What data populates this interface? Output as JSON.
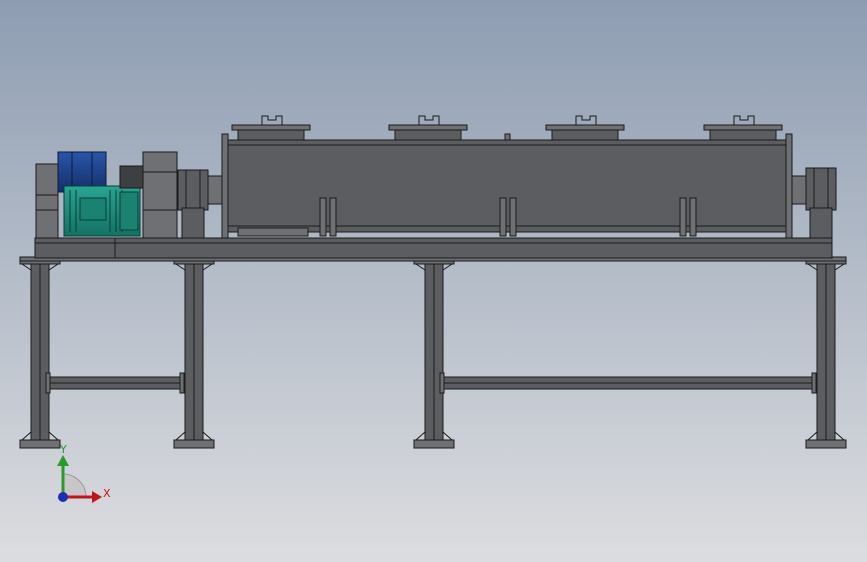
{
  "view": {
    "background_top": "#8e9db2",
    "background_bottom": "#dcdde0"
  },
  "model": {
    "steel_color": "#5b5d60",
    "steel_light": "#6e7073",
    "edge_color": "#1a1a1a",
    "motor_color": "#1f8f7e",
    "gearbox_color": "#1d3e86"
  },
  "triad": {
    "x_label": "X",
    "y_label": "Y",
    "x_color": "#c0161d",
    "y_color": "#2a9a2a",
    "z_color": "#1c2fb0"
  }
}
